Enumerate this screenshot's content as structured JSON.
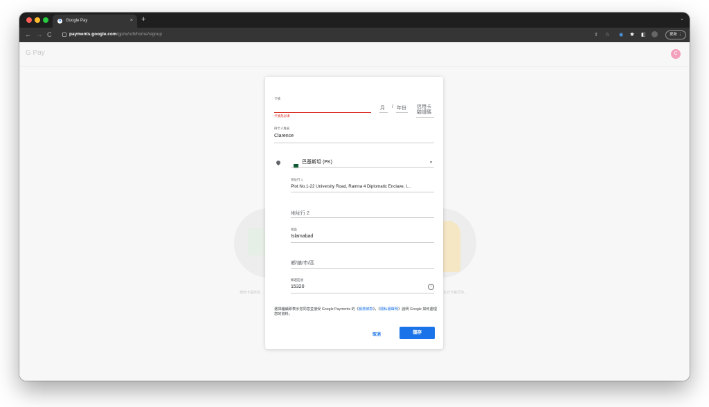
{
  "browser": {
    "tab_title": "Google Pay",
    "tab_favicon": "G",
    "tab_close": "×",
    "new_tab": "+",
    "url_host": "payments.google.com",
    "url_path": "/gp/w/u/8/home/signup",
    "update_button": "更新",
    "profile_initial": "C",
    "icons": [
      "back-icon",
      "forward-icon",
      "reload-icon",
      "lock-icon",
      "share-icon",
      "star-icon",
      "extension-icon",
      "puzzle-icon",
      "sidepanel-icon",
      "more-icon"
    ]
  },
  "app": {
    "logo": "G Pay",
    "avatar_initial": "C",
    "background_left_text": "使你卡是所有…",
    "background_right_text": "方式卡帳行你…"
  },
  "form": {
    "card_number_label": "卡號",
    "card_number_error": "卡號為必填",
    "expiry_month_placeholder": "月",
    "expiry_separator": "/",
    "expiry_year_placeholder": "年份",
    "cvc_placeholder": "信用卡驗證碼",
    "cardholder_label": "持卡人姓名",
    "cardholder_value": "Clarence",
    "country_value": "巴基斯坦 (PK)",
    "address1_label": "地址行 1",
    "address1_value": "Plot No.1-22 University Road, Ramna 4 Diplomatic Enclave, I...",
    "address2_placeholder": "地址行 2",
    "district_label": "街區",
    "district_value": "Islamabad",
    "city_placeholder": "鄉/鎮/市/區",
    "postal_label": "郵遞區號",
    "postal_value": "15320",
    "info_glyph": "i",
    "terms_prefix": "選擇繼續即表示您同意並接受 Google Payments 的《",
    "terms_link": "服務條款",
    "terms_mid": "》，《",
    "privacy_link": "隱私權聲明",
    "terms_suffix": "》說明 Google 如何處理您的資料。",
    "cancel_button": "取消",
    "save_button": "儲存"
  },
  "colors": {
    "accent": "#1a73e8",
    "error": "#d93025",
    "avatar": "#f2a0bc"
  }
}
